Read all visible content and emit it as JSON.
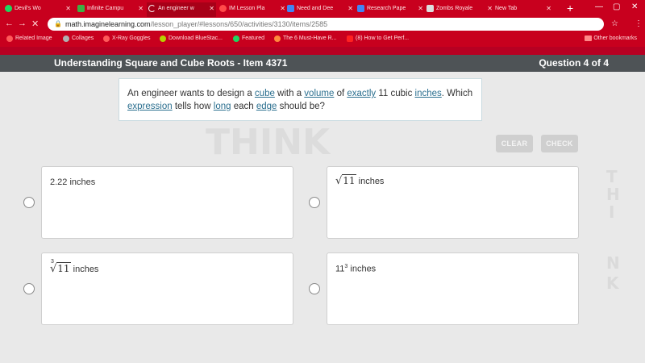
{
  "browser": {
    "tabs": [
      {
        "label": "Devil's Wo",
        "icon": "spotify-icon",
        "color": "#1ed760",
        "active": false
      },
      {
        "label": "Infinite Campu",
        "icon": "campus-icon",
        "color": "#3cb043",
        "active": false
      },
      {
        "label": "An engineer w",
        "icon": "loading-icon",
        "color": "#ffffff",
        "active": true
      },
      {
        "label": "IM Lesson Pla",
        "icon": "lesson-icon",
        "color": "#ff4a4a",
        "active": false
      },
      {
        "label": "Need and Dee",
        "icon": "docs-icon",
        "color": "#4285f4",
        "active": false
      },
      {
        "label": "Research Pape",
        "icon": "docs-icon",
        "color": "#4285f4",
        "active": false
      },
      {
        "label": "Zombs Royale",
        "icon": "zombs-icon",
        "color": "#dddddd",
        "active": false
      },
      {
        "label": "New Tab",
        "icon": "",
        "color": "",
        "active": false
      }
    ],
    "url_host": "math.imaginelearning.com",
    "url_path": "/lesson_player/#lessons/650/activities/3130/items/2585",
    "bookmarks": [
      {
        "label": "Related Image",
        "color": "#ff5a5a"
      },
      {
        "label": "Collages",
        "color": "#b0b0b0"
      },
      {
        "label": "X-Ray Goggles",
        "color": "#ff5a5a"
      },
      {
        "label": "Download BlueStac...",
        "color": "#b7d000"
      },
      {
        "label": "Featured",
        "color": "#1ed760"
      },
      {
        "label": "The 6 Must-Have R...",
        "color": "#ff8a3d"
      },
      {
        "label": "(8) How to Get Perf...",
        "color": "#ff2020"
      }
    ],
    "other_bookmarks": "Other bookmarks"
  },
  "header": {
    "lesson_title": "Understanding Square and Cube Roots - Item 4371",
    "question_counter": "Question 4 of 4"
  },
  "question": {
    "parts": [
      {
        "text": "An engineer wants to design a ",
        "vocab": false
      },
      {
        "text": "cube",
        "vocab": true
      },
      {
        "text": " with a ",
        "vocab": false
      },
      {
        "text": "volume",
        "vocab": true
      },
      {
        "text": " of ",
        "vocab": false
      },
      {
        "text": "exactly",
        "vocab": true
      },
      {
        "text": " 11 cubic ",
        "vocab": false
      },
      {
        "text": "inches",
        "vocab": true
      },
      {
        "text": ". Which ",
        "vocab": false
      },
      {
        "text": "expression",
        "vocab": true
      },
      {
        "text": " tells how ",
        "vocab": false
      },
      {
        "text": "long",
        "vocab": true
      },
      {
        "text": " each ",
        "vocab": false
      },
      {
        "text": "edge",
        "vocab": true
      },
      {
        "text": " should be?",
        "vocab": false
      }
    ]
  },
  "buttons": {
    "clear": "CLEAR",
    "check": "CHECK"
  },
  "choices": {
    "a": {
      "value": "2.22",
      "unit": " inches"
    },
    "b": {
      "radicand": "11",
      "unit": " inches"
    },
    "c": {
      "index": "3",
      "radicand": "11",
      "unit": " inches"
    },
    "d": {
      "base": "11",
      "exponent": "3",
      "unit": " inches"
    }
  },
  "background_words": [
    "THINK",
    "T",
    "H",
    "I",
    "N",
    "K"
  ]
}
